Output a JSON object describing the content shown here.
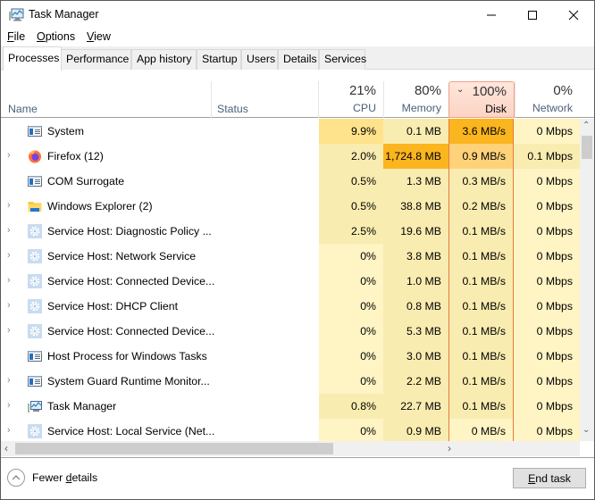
{
  "window": {
    "title": "Task Manager"
  },
  "menu": [
    {
      "label": "File",
      "accel": "F",
      "rest": "ile"
    },
    {
      "label": "Options",
      "accel": "O",
      "rest": "ptions"
    },
    {
      "label": "View",
      "accel": "V",
      "rest": "iew"
    }
  ],
  "tabs": [
    {
      "label": "Processes",
      "active": true
    },
    {
      "label": "Performance",
      "active": false
    },
    {
      "label": "App history",
      "active": false
    },
    {
      "label": "Startup",
      "active": false
    },
    {
      "label": "Users",
      "active": false
    },
    {
      "label": "Details",
      "active": false
    },
    {
      "label": "Services",
      "active": false
    }
  ],
  "columns": {
    "name": "Name",
    "status": "Status",
    "cpu": {
      "percent": "21%",
      "label": "CPU"
    },
    "memory": {
      "percent": "80%",
      "label": "Memory"
    },
    "disk": {
      "percent": "100%",
      "label": "Disk",
      "sorted": true
    },
    "network": {
      "percent": "0%",
      "label": "Network"
    }
  },
  "colors": {
    "heat_light": "#fff4c4",
    "heat_low": "#f9ecb0",
    "heat_mid": "#ffe38c",
    "heat_medhigh": "#ffd27a",
    "heat_high": "#fcc45a",
    "heat_max": "#fbb51e",
    "sorted_border": "#e8793e"
  },
  "processes": [
    {
      "name": "System",
      "expandable": false,
      "icon": "window-app-icon",
      "cpu": "9.9%",
      "memory": "0.1 MB",
      "disk": "3.6 MB/s",
      "network": "0 Mbps",
      "heat": {
        "cpu": "mid",
        "memory": "low",
        "disk": "max",
        "network": "light"
      }
    },
    {
      "name": "Firefox (12)",
      "expandable": true,
      "icon": "firefox-icon",
      "cpu": "2.0%",
      "memory": "1,724.8 MB",
      "disk": "0.9 MB/s",
      "network": "0.1 Mbps",
      "heat": {
        "cpu": "low",
        "memory": "max",
        "disk": "medhigh",
        "network": "low"
      }
    },
    {
      "name": "COM Surrogate",
      "expandable": false,
      "icon": "window-app-icon",
      "cpu": "0.5%",
      "memory": "1.3 MB",
      "disk": "0.3 MB/s",
      "network": "0 Mbps",
      "heat": {
        "cpu": "low",
        "memory": "low",
        "disk": "low",
        "network": "light"
      }
    },
    {
      "name": "Windows Explorer (2)",
      "expandable": true,
      "icon": "folder-icon",
      "cpu": "0.5%",
      "memory": "38.8 MB",
      "disk": "0.2 MB/s",
      "network": "0 Mbps",
      "heat": {
        "cpu": "low",
        "memory": "low",
        "disk": "low",
        "network": "light"
      }
    },
    {
      "name": "Service Host: Diagnostic Policy ...",
      "expandable": true,
      "icon": "gear-icon",
      "cpu": "2.5%",
      "memory": "19.6 MB",
      "disk": "0.1 MB/s",
      "network": "0 Mbps",
      "heat": {
        "cpu": "low",
        "memory": "low",
        "disk": "low",
        "network": "light"
      }
    },
    {
      "name": "Service Host: Network Service",
      "expandable": true,
      "icon": "gear-icon",
      "cpu": "0%",
      "memory": "3.8 MB",
      "disk": "0.1 MB/s",
      "network": "0 Mbps",
      "heat": {
        "cpu": "light",
        "memory": "low",
        "disk": "low",
        "network": "light"
      }
    },
    {
      "name": "Service Host: Connected Device...",
      "expandable": true,
      "icon": "gear-icon",
      "cpu": "0%",
      "memory": "1.0 MB",
      "disk": "0.1 MB/s",
      "network": "0 Mbps",
      "heat": {
        "cpu": "light",
        "memory": "low",
        "disk": "low",
        "network": "light"
      }
    },
    {
      "name": "Service Host: DHCP Client",
      "expandable": true,
      "icon": "gear-icon",
      "cpu": "0%",
      "memory": "0.8 MB",
      "disk": "0.1 MB/s",
      "network": "0 Mbps",
      "heat": {
        "cpu": "light",
        "memory": "low",
        "disk": "low",
        "network": "light"
      }
    },
    {
      "name": "Service Host: Connected Device...",
      "expandable": true,
      "icon": "gear-icon",
      "cpu": "0%",
      "memory": "5.3 MB",
      "disk": "0.1 MB/s",
      "network": "0 Mbps",
      "heat": {
        "cpu": "light",
        "memory": "low",
        "disk": "low",
        "network": "light"
      }
    },
    {
      "name": "Host Process for Windows Tasks",
      "expandable": false,
      "icon": "window-app-icon",
      "cpu": "0%",
      "memory": "3.0 MB",
      "disk": "0.1 MB/s",
      "network": "0 Mbps",
      "heat": {
        "cpu": "light",
        "memory": "low",
        "disk": "low",
        "network": "light"
      }
    },
    {
      "name": "System Guard Runtime Monitor...",
      "expandable": true,
      "icon": "window-app-icon",
      "cpu": "0%",
      "memory": "2.2 MB",
      "disk": "0.1 MB/s",
      "network": "0 Mbps",
      "heat": {
        "cpu": "light",
        "memory": "low",
        "disk": "low",
        "network": "light"
      }
    },
    {
      "name": "Task Manager",
      "expandable": true,
      "icon": "task-manager-icon",
      "cpu": "0.8%",
      "memory": "22.7 MB",
      "disk": "0.1 MB/s",
      "network": "0 Mbps",
      "heat": {
        "cpu": "low",
        "memory": "low",
        "disk": "low",
        "network": "light"
      }
    },
    {
      "name": "Service Host: Local Service (Net...",
      "expandable": true,
      "icon": "gear-icon",
      "cpu": "0%",
      "memory": "0.9 MB",
      "disk": "0 MB/s",
      "network": "0 Mbps",
      "heat": {
        "cpu": "light",
        "memory": "low",
        "disk": "light",
        "network": "light"
      }
    }
  ],
  "footer": {
    "fewer_details": {
      "pre": "Fewer ",
      "accel": "d",
      "post": "etails"
    },
    "end_task": {
      "accel": "E",
      "post": "nd task"
    }
  }
}
